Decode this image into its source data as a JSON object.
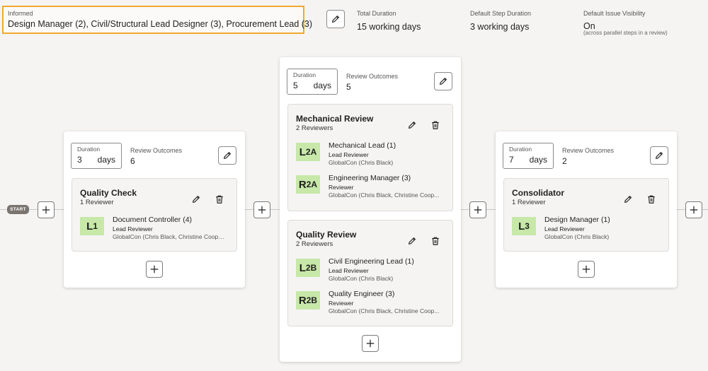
{
  "header": {
    "informed_label": "Informed",
    "informed_value": "Design Manager (2), Civil/Structural Lead Designer (3), Procurement Lead (3)",
    "total_duration_label": "Total Duration",
    "total_duration_value": "15 working days",
    "default_step_label": "Default Step Duration",
    "default_step_value": "3 working days",
    "visibility_label": "Default Issue Visibility",
    "visibility_value": "On",
    "visibility_note": "(across parallel steps in a review)"
  },
  "flow": {
    "start_label": "START"
  },
  "cards": [
    {
      "duration_label": "Duration",
      "duration_value": "3",
      "duration_unit": "days",
      "outcomes_label": "Review Outcomes",
      "outcomes_value": "6",
      "steps": [
        {
          "title": "Quality Check",
          "subtitle": "1 Reviewer",
          "reviewers": [
            {
              "badge_letter": "L",
              "badge_code": "1",
              "name": "Document Controller (4)",
              "role": "Lead Reviewer",
              "org": "GlobalCon (Chris Black, Christine Coope..."
            }
          ]
        }
      ]
    },
    {
      "duration_label": "Duration",
      "duration_value": "5",
      "duration_unit": "days",
      "outcomes_label": "Review Outcomes",
      "outcomes_value": "5",
      "steps": [
        {
          "title": "Mechanical Review",
          "subtitle": "2 Reviewers",
          "reviewers": [
            {
              "badge_letter": "L",
              "badge_code": "2A",
              "name": "Mechanical Lead (1)",
              "role": "Lead Reviewer",
              "org": "GlobalCon (Chris Black)"
            },
            {
              "badge_letter": "R",
              "badge_code": "2A",
              "name": "Engineering Manager (3)",
              "role": "Reviewer",
              "org": "GlobalCon (Chris Black, Christine Coop..."
            }
          ]
        },
        {
          "title": "Quality Review",
          "subtitle": "2 Reviewers",
          "reviewers": [
            {
              "badge_letter": "L",
              "badge_code": "2B",
              "name": "Civil Engineering Lead (1)",
              "role": "Lead Reviewer",
              "org": "GlobalCon (Chris Black)"
            },
            {
              "badge_letter": "R",
              "badge_code": "2B",
              "name": "Quality Engineer (3)",
              "role": "Reviewer",
              "org": "GlobalCon (Chris Black, Christine Coop..."
            }
          ]
        }
      ]
    },
    {
      "duration_label": "Duration",
      "duration_value": "7",
      "duration_unit": "days",
      "outcomes_label": "Review Outcomes",
      "outcomes_value": "2",
      "steps": [
        {
          "title": "Consolidator",
          "subtitle": "1 Reviewer",
          "reviewers": [
            {
              "badge_letter": "L",
              "badge_code": "3",
              "name": "Design Manager (1)",
              "role": "Lead Reviewer",
              "org": "GlobalCon (Chris Black)"
            }
          ]
        }
      ]
    }
  ],
  "icons": {
    "edit": "pencil-icon",
    "delete": "trash-icon",
    "add": "plus-icon"
  },
  "colors": {
    "highlight_border": "#f0a830",
    "badge_bg": "#c7e8a8",
    "start_badge": "#7a7470"
  }
}
